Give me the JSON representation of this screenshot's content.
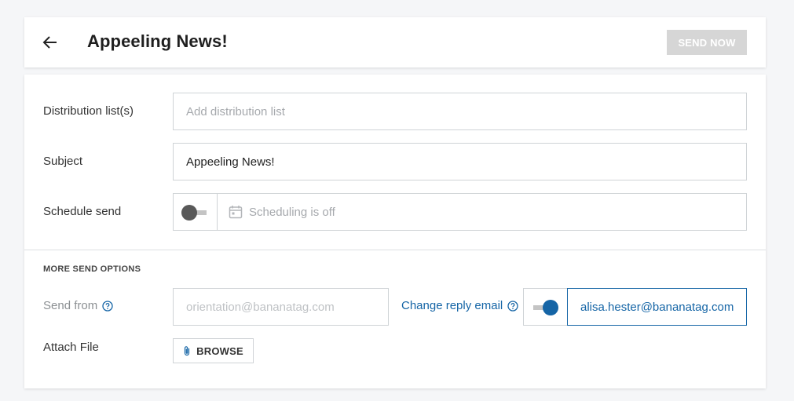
{
  "header": {
    "back_icon": "arrow-left-icon",
    "title": "Appeeling News!",
    "send_now_label": "SEND NOW"
  },
  "form": {
    "distribution": {
      "label": "Distribution list(s)",
      "placeholder": "Add distribution list",
      "value": ""
    },
    "subject": {
      "label": "Subject",
      "value": "Appeeling News!"
    },
    "schedule": {
      "label": "Schedule send",
      "toggle_on": false,
      "calendar_icon": "calendar-icon",
      "status_text": "Scheduling is off"
    }
  },
  "more_options": {
    "heading": "MORE SEND OPTIONS",
    "send_from": {
      "label": "Send from",
      "value": "orientation@bananatag.com",
      "help_icon": "help-circle-icon"
    },
    "reply": {
      "label": "Change reply email",
      "toggle_on": true,
      "value": "alisa.hester@bananatag.com",
      "help_icon": "help-circle-icon"
    },
    "attach": {
      "label": "Attach File",
      "button_label": "BROWSE",
      "button_icon": "paperclip-icon"
    }
  },
  "colors": {
    "accent": "#1565a6",
    "toggle_off_knob": "#595959",
    "toggle_track": "#c4c4c4",
    "disabled_button": "#d6d6d6",
    "page_bg": "#f5f6f8"
  }
}
